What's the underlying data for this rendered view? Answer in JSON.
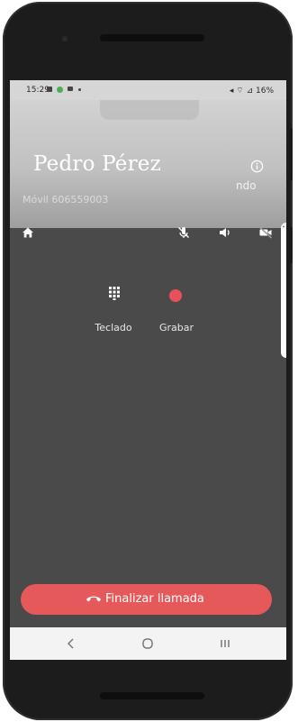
{
  "status_bar": {
    "time": "15:29",
    "right_text": "◂ ⌔ ⊿ 16%",
    "icons": [
      "call-icon",
      "green-dot-icon",
      "message-icon",
      "dot-icon"
    ]
  },
  "call": {
    "contact_name": "Pedro Pérez",
    "subtitle": "Móvil 606559003",
    "info_text": "ndo",
    "toolbar": [
      "home-icon",
      "mute-icon",
      "speaker-icon",
      "video-off-icon"
    ]
  },
  "actions": {
    "keypad_label": "Teclado",
    "record_label": "Grabar",
    "record_color": "#e8505b"
  },
  "end_call": {
    "label": "Finalizar llamada",
    "color": "#e5595a"
  },
  "navbar": [
    "back-icon",
    "home-circle-icon",
    "recents-icon"
  ]
}
